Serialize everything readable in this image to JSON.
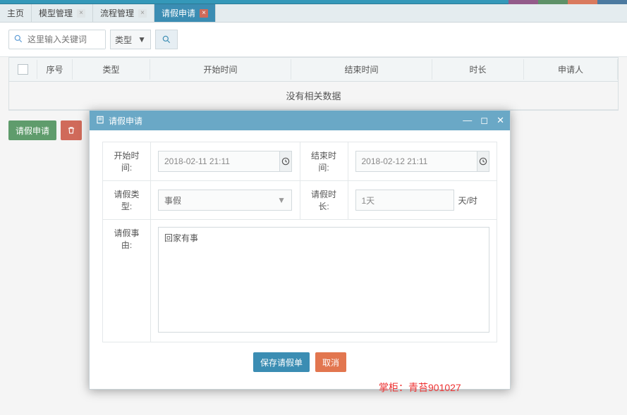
{
  "tabs": [
    {
      "label": "主页",
      "closable": false
    },
    {
      "label": "模型管理",
      "closable": true
    },
    {
      "label": "流程管理",
      "closable": true
    },
    {
      "label": "请假申请",
      "closable": true,
      "active": true
    }
  ],
  "filter": {
    "keyword_placeholder": "这里输入关键词",
    "type_label": "类型"
  },
  "table": {
    "headers": {
      "seq": "序号",
      "type": "类型",
      "start": "开始时间",
      "end": "结束时间",
      "dur": "时长",
      "applicant": "申请人"
    },
    "no_data": "没有相关数据"
  },
  "page_actions": {
    "apply": "请假申请"
  },
  "modal": {
    "title": "请假申请",
    "labels": {
      "start": "开始时间:",
      "end": "结束时间:",
      "type": "请假类型:",
      "dur": "请假时长:",
      "dur_unit": "天/时",
      "reason": "请假事由:"
    },
    "values": {
      "start": "2018-02-11 21:11",
      "end": "2018-02-12 21:11",
      "type": "事假",
      "dur": "1天",
      "reason": "回家有事"
    },
    "buttons": {
      "save": "保存请假单",
      "cancel": "取消"
    }
  },
  "watermark": "掌柜：青苔901027"
}
